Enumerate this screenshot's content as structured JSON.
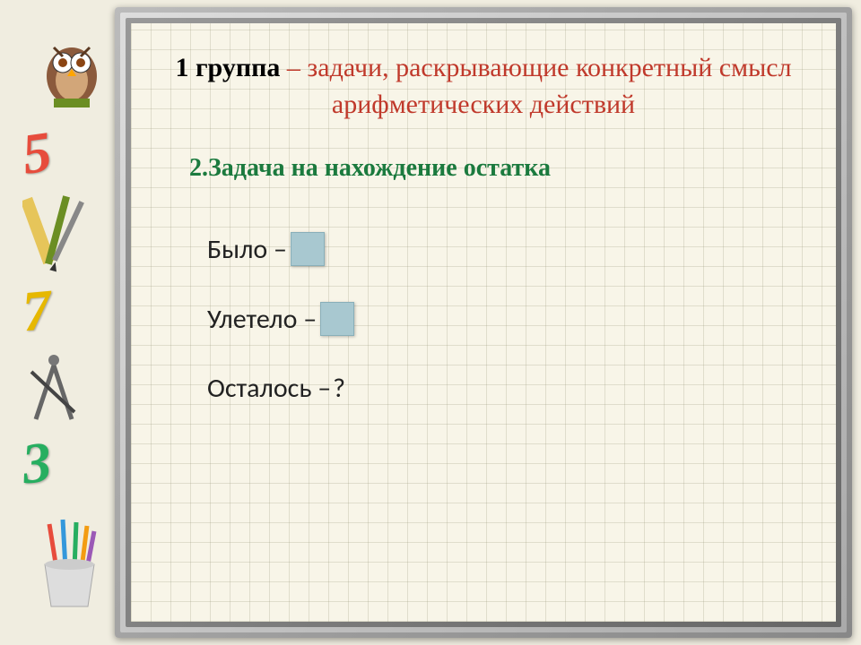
{
  "title": {
    "bold": "1 группа",
    "rest": " – задачи, раскрывающие конкретный смысл арифметических действий"
  },
  "subtitle": "2.Задача на нахождение остатка",
  "rows": {
    "r1": {
      "label": "Было – ",
      "boxed": true
    },
    "r2": {
      "label": "Улетело – ",
      "boxed": true
    },
    "r3": {
      "label": "Осталось – ",
      "value": "?"
    }
  },
  "sidebar": {
    "numbers": {
      "n5": "5",
      "n7": "7",
      "n3": "3"
    }
  }
}
